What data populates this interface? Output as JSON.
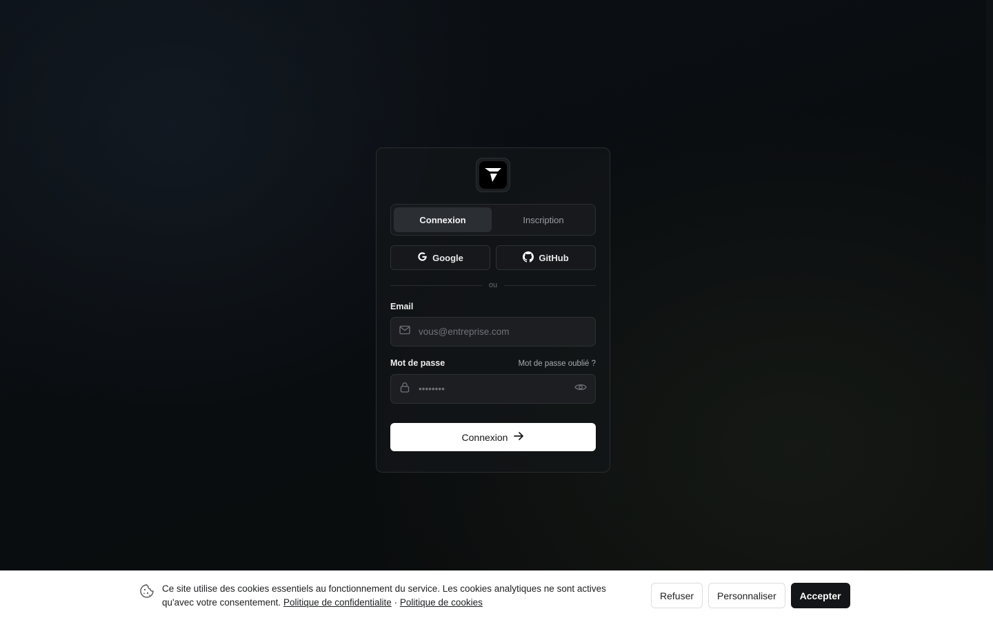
{
  "auth": {
    "logo_icon": "app-logo-arrow-icon",
    "tabs": [
      {
        "label": "Connexion",
        "active": true
      },
      {
        "label": "Inscription",
        "active": false
      }
    ],
    "oauth": {
      "google_label": "Google",
      "github_label": "GitHub"
    },
    "divider_text": "ou",
    "email": {
      "label": "Email",
      "placeholder": "vous@entreprise.com",
      "icon": "mail-icon"
    },
    "password": {
      "label": "Mot de passe",
      "forgot_label": "Mot de passe oublié ?",
      "placeholder": "••••••••",
      "icon": "lock-icon",
      "toggle_icon": "eye-icon"
    },
    "submit_label": "Connexion",
    "submit_icon": "arrow-right-icon"
  },
  "cookie_banner": {
    "icon": "cookie-icon",
    "text": "Ce site utilise des cookies essentiels au fonctionnement du service. Les cookies analytiques ne sont actives qu'avec votre consentement.",
    "privacy_link": "Politique de confidentialite",
    "separator": "·",
    "cookies_link": "Politique de cookies",
    "buttons": {
      "refuse": "Refuser",
      "customize": "Personnaliser",
      "accept": "Accepter"
    }
  },
  "colors": {
    "background": "#0b0e12",
    "card_border": "#2a2d31",
    "primary_button": "#ffffff",
    "accept_button": "#141518"
  }
}
